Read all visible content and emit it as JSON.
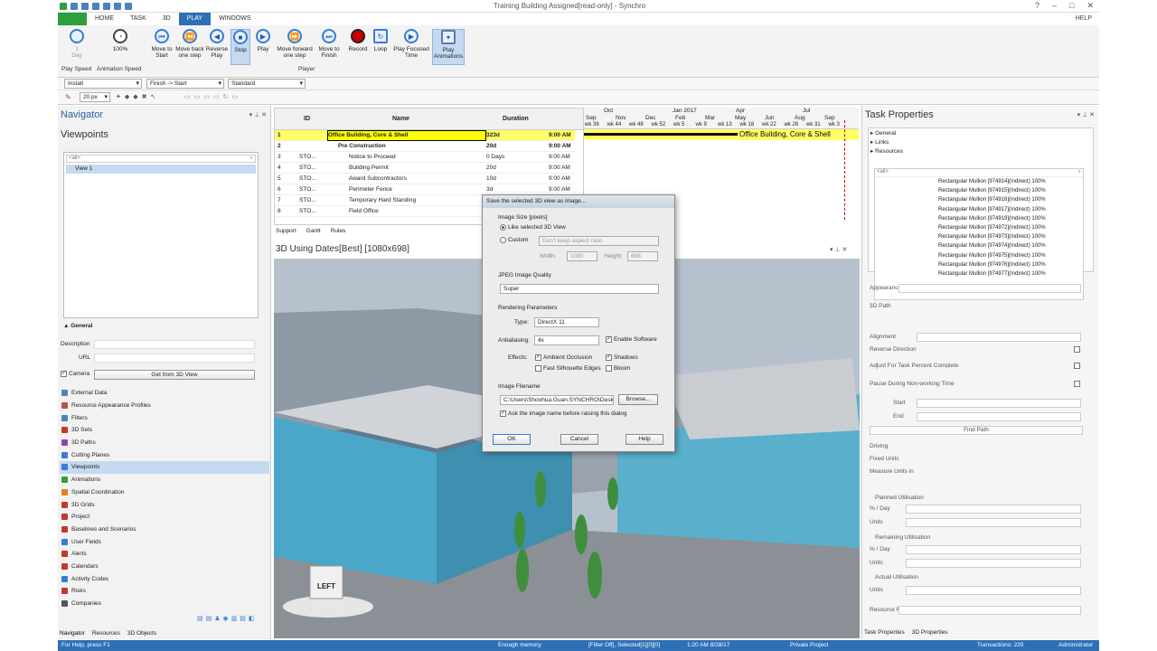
{
  "window": {
    "title": "Training Building Assigned[read-only] - Synchro",
    "help": "HELP"
  },
  "tabs": [
    "HOME",
    "TASK",
    "3D",
    "PLAY",
    "WINDOWS"
  ],
  "ribbon": {
    "play_speed_value": "1",
    "play_speed_unit": "Day",
    "play_speed_label": "Play Speed",
    "anim_speed_value": "100%",
    "anim_speed_label": "Animation Speed",
    "buttons": [
      {
        "label": "Move to Start",
        "icon": "skip-start-icon"
      },
      {
        "label": "Move back one step",
        "icon": "step-back-icon"
      },
      {
        "label": "Reverse Play",
        "icon": "reverse-play-icon"
      },
      {
        "label": "Stop",
        "icon": "stop-icon"
      },
      {
        "label": "Play",
        "icon": "play-icon"
      },
      {
        "label": "Move forward one step",
        "icon": "step-forward-icon"
      },
      {
        "label": "Move to Finish",
        "icon": "skip-end-icon"
      },
      {
        "label": "Record",
        "icon": "record-icon"
      },
      {
        "label": "Loop",
        "icon": "loop-icon"
      },
      {
        "label": "Play Focused Time",
        "icon": "focused-time-icon"
      },
      {
        "label": "Play Animations",
        "icon": "animations-icon"
      }
    ],
    "group_label": "Player"
  },
  "toolbar": {
    "combo1": "Install",
    "combo2": "Finish -> Start",
    "combo3": "Standard",
    "size": "20 px"
  },
  "navigator": {
    "title": "Navigator",
    "section": "Viewpoints",
    "filter": "<all>",
    "views": [
      "View 1"
    ],
    "general_label": "General",
    "description_label": "Description",
    "url_label": "URL",
    "camera_label": "Camera",
    "get_from_3d": "Get from 3D View",
    "items": [
      "External Data",
      "Resource Appearance Profiles",
      "Filters",
      "3D Sets",
      "3D Paths",
      "Cutting Planes",
      "Viewpoints",
      "Animations",
      "Spatial Coordination",
      "3D Grids",
      "Project",
      "Baselines and Scenarios",
      "User Fields",
      "Alerts",
      "Calendars",
      "Activity Codes",
      "Risks",
      "Companies"
    ],
    "item_colors": [
      "#4f81bd",
      "#c0504d",
      "#4f81bd",
      "#c0392b",
      "#8e44ad",
      "#3a7bd5",
      "#3a7bd5",
      "#2e9e3e",
      "#e67e22",
      "#c0392b",
      "#c0392b",
      "#c0392b",
      "#3a7bd5",
      "#c0392b",
      "#c0392b",
      "#3a7bd5",
      "#c0392b",
      "#555555"
    ],
    "bottom_tabs": [
      "Navigator",
      "Resources",
      "3D Objects"
    ]
  },
  "grid": {
    "headers": {
      "id": "ID",
      "name": "Name",
      "duration": "Duration"
    },
    "rows": [
      {
        "n": "1",
        "id": "",
        "name": "Office Building, Core & Shell",
        "dur": "323d",
        "time": "9:00 AM"
      },
      {
        "n": "2",
        "id": "",
        "name": "Pre Construction",
        "dur": "20d",
        "time": "9:00 AM"
      },
      {
        "n": "3",
        "id": "STO...",
        "name": "Notice to Proceed",
        "dur": "0 Days",
        "time": "9:00 AM"
      },
      {
        "n": "4",
        "id": "STO...",
        "name": "Building Permit",
        "dur": "20d",
        "time": "9:00 AM"
      },
      {
        "n": "5",
        "id": "STO...",
        "name": "Award Subcontractors",
        "dur": "10d",
        "time": "9:00 AM"
      },
      {
        "n": "6",
        "id": "STO...",
        "name": "Perimeter Fence",
        "dur": "3d",
        "time": "9:00 AM"
      },
      {
        "n": "7",
        "id": "STO...",
        "name": "Temporary Hard Standing",
        "dur": "",
        "time": "9:00 AM"
      },
      {
        "n": "8",
        "id": "STO...",
        "name": "Field Office",
        "dur": "",
        "time": "9:00 AM"
      }
    ],
    "tabs": [
      "Support",
      "Gantt",
      "Rules"
    ]
  },
  "gantt": {
    "months": [
      "Oct",
      "Jan 2017",
      "Apr",
      "Jul"
    ],
    "months2": [
      "Sep",
      "Nov",
      "Dec",
      "Feb",
      "Mar",
      "May",
      "Jun",
      "Aug",
      "Sep"
    ],
    "weeks": [
      "wk 39",
      "wk 44",
      "wk 48",
      "wk 52",
      "wk 5",
      "wk 9",
      "wk 13",
      "wk 18",
      "wk 22",
      "wk 26",
      "wk 31",
      "wk 3"
    ],
    "bar_label": "Office Building, Core & Shell"
  },
  "view3d": {
    "title": "3D Using Dates[Best] [1080x698]",
    "cube_label": "LEFT"
  },
  "dialog": {
    "title": "Save the selected 3D view as image...",
    "image_size": "Image Size [pixels]",
    "like_selected": "Like selected 3D View",
    "custom": "Custom",
    "aspect": "Don't keep aspect ratio",
    "width_label": "Width:",
    "width_value": "1080",
    "height_label": "Height:",
    "height_value": "698",
    "jpeg_quality": "JPEG Image Quality",
    "quality_value": "Super",
    "rendering": "Rendering Parameters",
    "type_label": "Type:",
    "type_value": "DirectX 11",
    "antialias_label": "Antialiasing:",
    "antialias_value": "4x",
    "enable_software": "Enable Software",
    "effects_label": "Effects:",
    "ambient": "Ambient Occlusion",
    "shadows": "Shadows",
    "silhouette": "Fast Silhouette Edges",
    "bloom": "Bloom",
    "filename_label": "Image Filename",
    "filename_value": "C:\\Users\\Shoohua.Guan.SYNCHRO\\Desk",
    "browse": "Browse...",
    "ask_name": "Ask the image name before raising this dialog",
    "ok": "OK",
    "cancel": "Cancel",
    "help": "Help"
  },
  "task_properties": {
    "title": "Task Properties",
    "tree": [
      "General",
      "Links",
      "Resources"
    ],
    "filter": "<all>",
    "resources": [
      "Rectangular Mullion [974914](Indirect) 100%",
      "Rectangular Mullion [974915](Indirect) 100%",
      "Rectangular Mullion [974916](Indirect) 100%",
      "Rectangular Mullion [974917](Indirect) 100%",
      "Rectangular Mullion [974919](Indirect) 100%",
      "Rectangular Mullion [974972](Indirect) 100%",
      "Rectangular Mullion [974973](Indirect) 100%",
      "Rectangular Mullion [974974](Indirect) 100%",
      "Rectangular Mullion [974975](Indirect) 100%",
      "Rectangular Mullion [974976](Indirect) 100%",
      "Rectangular Mullion [974977](Indirect) 100%"
    ],
    "appearance_profile": "Appearance Profile",
    "path3d": "3D Path",
    "alignment": "Alignment",
    "reverse": "Reverse Direction",
    "adjust": "Adjust For Task Percent Complete",
    "pause": "Pause During Non-working Time",
    "start": "Start",
    "end": "End",
    "find_path": "Find Path",
    "driving": "Driving",
    "fixed_units": "Fixed Units",
    "measure_units": "Measure Units in",
    "planned": "Planned Utilisation",
    "remaining": "Remaining Utilisation",
    "actual": "Actual Utilisation",
    "per_day": "% / Day",
    "units": "Units",
    "resource_role": "Resource Role",
    "bottom_tabs": [
      "Task Properties",
      "3D Properties"
    ]
  },
  "status": {
    "left": "For Help, press F1",
    "memory": "Enough memory",
    "filter": "[Filter Off], Selected[1][0][0]",
    "time": "1:20 AM 8/28/17",
    "project": "Private Project",
    "transactions": "Transactions: 220",
    "user": "Administrator"
  }
}
